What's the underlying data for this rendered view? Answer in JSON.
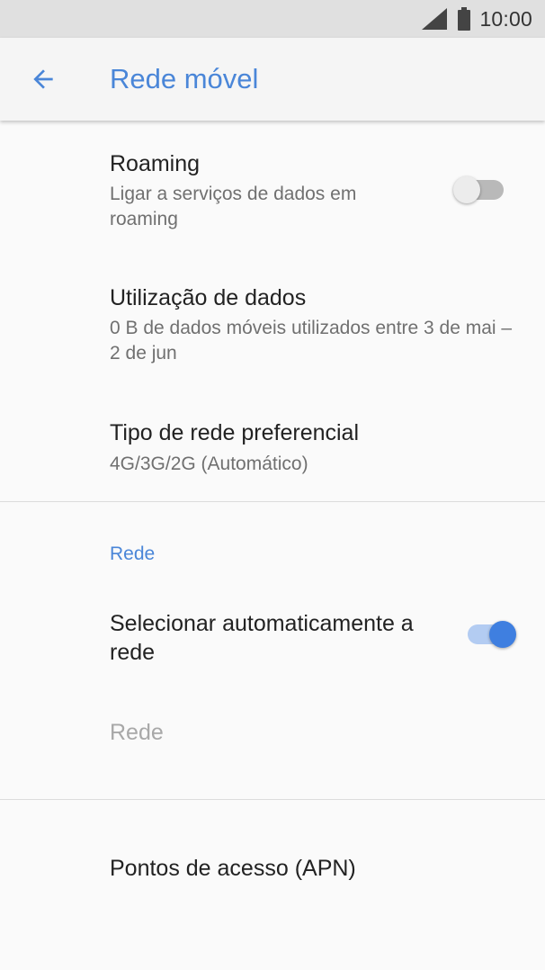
{
  "status_bar": {
    "time": "10:00"
  },
  "app_bar": {
    "title": "Rede móvel"
  },
  "settings": {
    "roaming": {
      "title": "Roaming",
      "summary": "Ligar a serviços de dados em roaming",
      "enabled": false
    },
    "data_usage": {
      "title": "Utilização de dados",
      "summary": "0 B de dados móveis utilizados entre 3 de mai – 2 de jun"
    },
    "preferred_network": {
      "title": "Tipo de rede preferencial",
      "summary": "4G/3G/2G (Automático)"
    },
    "network_section": {
      "header": "Rede",
      "auto_select": {
        "title": "Selecionar automaticamente a rede",
        "enabled": true
      },
      "network": {
        "title": "Rede"
      }
    },
    "apn": {
      "title": "Pontos de acesso (APN)"
    }
  },
  "colors": {
    "accent": "#4a86d8",
    "status_bar_bg": "#e0e0e0",
    "background": "#fafafa"
  }
}
